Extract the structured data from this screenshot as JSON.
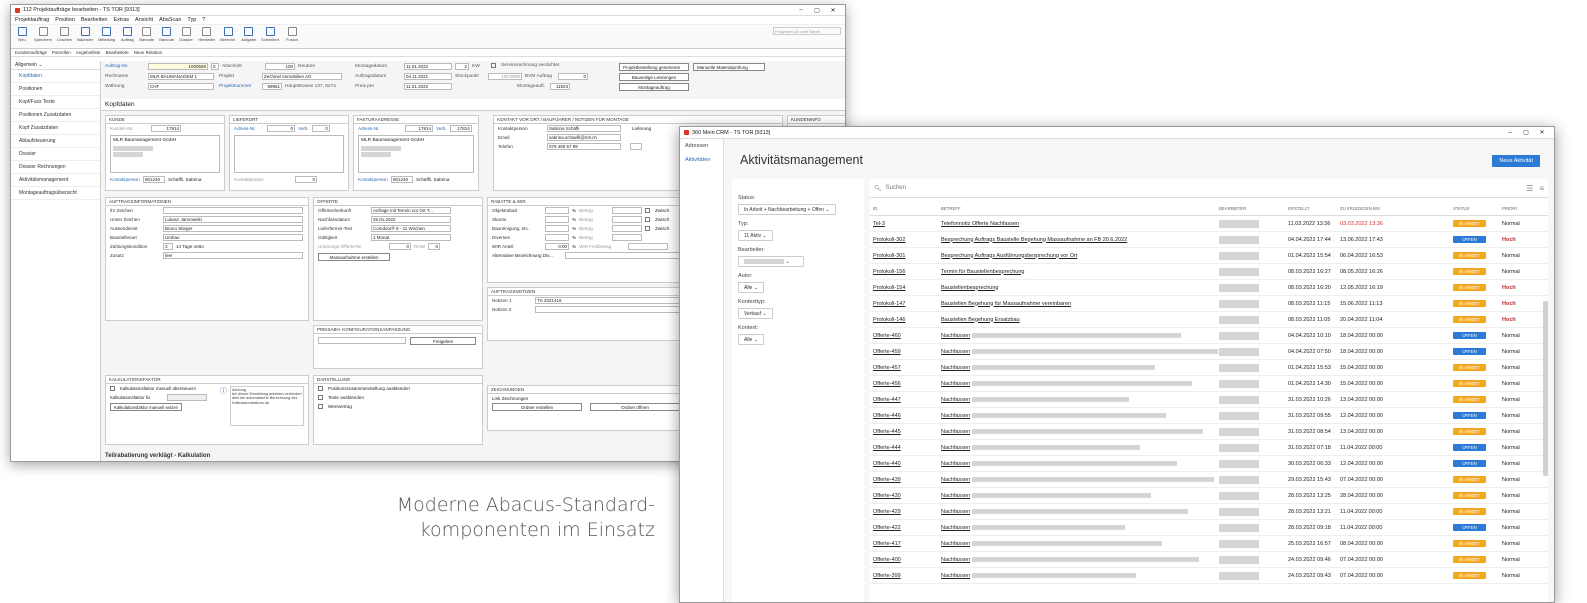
{
  "win1": {
    "title": "112 Projektaufträge bearbeiten - TS TOR [9313]",
    "menu": [
      "Projektauftrag",
      "Position",
      "Bearbeiten",
      "Extras",
      "Ansicht",
      "AbaScan",
      "Typ",
      "?"
    ],
    "ribbon": [
      "Neu",
      "Speichern",
      "Löschen",
      "Nächster",
      "Mitteilung",
      "Auftrag",
      "Barcode",
      "Barcode",
      "Dossier",
      "Hersteller",
      "Berechn.",
      "Aufgabe",
      "Schnellerf.",
      "Fusion"
    ],
    "program_search": "Programm-ID oder Name",
    "subbar": [
      "Kundenaufträge",
      "Parzellen",
      "Angebotliste",
      "Bearbeitete",
      "Neue Relation"
    ],
    "side_select": "Allgemein",
    "side_items": [
      "Kopfdaten",
      "Positionen",
      "Kopf/Fuss Texte",
      "Positionen Zusatzdaten",
      "Kopf Zusatzdaten",
      "Ablaufsteuerung",
      "Dossier",
      "Dossier Rechnungen",
      "Aktivitätsmanagement",
      "Montageauftragsübersicht"
    ],
    "header": {
      "auftrag_nr_label": "Auftrag-Nr.",
      "auftrag_nr": "1000568",
      "auftrag_nr_sub": "0",
      "abschnitt_label": "Abschnitt",
      "abschnitt": "100",
      "neutral": "Neutore",
      "montagedatum_label": "Montagedatum",
      "montagedatum": "11.01.2022",
      "kw_num": "2",
      "kw_label": "KW",
      "servicerechnung": "Servicerechnung verdichtet",
      "projektbestellung": "Projektbestellung generieren",
      "materialpruefung": "Manuelle Materialprüfung",
      "rechname_label": "Rechname",
      "rechname": "MLR BAUMANAGEM 1",
      "projekt_label": "Projekt",
      "projekt": "Zechinel Immobilien AG",
      "auftragsdatum_label": "Auftragsdatum",
      "auftragsdatum": "04.11.2021",
      "stockpunkt_label": "Stockpunkt",
      "stockpunkt": "100.0000",
      "bvm_label": "BVM Auftrag",
      "bvm": "0",
      "bauseitige": "Bauseitige Leistungen",
      "waehrung_label": "Währung",
      "waehrung": "CHF",
      "projektnummer_label": "Projektnummer",
      "projektnummer": "99961",
      "adresse": "Hauptstrasse 137, 8274",
      "preis_label": "Preis per",
      "preis": "11.01.2022",
      "montageauft_label": "Montageauft.",
      "montageauft": "11923",
      "montageauftrag": "Montageauftrag"
    },
    "section_title": "Kopfdaten",
    "kunde": {
      "title": "KUNDE",
      "kunden_nr_label": "Kunden-Nr.",
      "kunden_nr": "17814",
      "name": "MLR Baumanagement GmbH",
      "kontakt_label": "Kontaktperson",
      "kontakt_nr": "801240",
      "kontakt_name": "Schäffli, Sabrina"
    },
    "lieferort": {
      "title": "LIEFERORT",
      "adress_label": "Adress-Nr.",
      "adress_nr": "0",
      "verb_label": "Verb.",
      "verb": "0",
      "kontakt_label": "Kontaktperson",
      "kontakt_nr": "0"
    },
    "faktura": {
      "title": "FAKTURAADRESSE",
      "adress_label": "Adress-Nr.",
      "adress_nr": "17814",
      "verb_label": "Verb.",
      "verb": "17814",
      "name": "MLR Baumanagement GmbH",
      "kontakt_label": "Kontaktperson",
      "kontakt_nr": "801240",
      "kontakt_name": "Schäffli, Sabrina"
    },
    "kontakt": {
      "title": "KONTAKT VOR ORT / BAUFÜHRER / NOTIZEN FÜR MONTAGE",
      "person_label": "Kontaktperson",
      "person": "Sabrina Schäfli",
      "lieferung": "Lieferung",
      "email_label": "Email",
      "email": "sabrina.schaefli@mlr.ch",
      "telefon_label": "Telefon",
      "telefon": "079 469 57 99"
    },
    "kundeninfo": {
      "title": "KUNDENINFO"
    },
    "auftragsinfo": {
      "title": "AUFTRAGSINFORMATIONEN",
      "rows": [
        [
          "Ihr Zeichen",
          ""
        ],
        [
          "Unser Zeichen",
          "Lukasz Jamrowski"
        ],
        [
          "Aussendienst",
          "Bruno Stieger"
        ],
        [
          "Baustellenart",
          "Umbau"
        ],
        [
          "Zahlungskondition",
          "14 Tage netto"
        ],
        [
          "Zusatz",
          "leer"
        ]
      ],
      "zk_num": "3"
    },
    "offerte": {
      "title": "OFFERTE",
      "rows": [
        [
          "Offertenherkunft",
          "Anfrage mit Termin vor Ort T..."
        ],
        [
          "Nachfassdatum",
          "26.01.2022"
        ],
        [
          "Lieferfermin-Text",
          "Comdoor® 8 - 11 Wochen"
        ],
        [
          "Gültigkeit",
          "1 Monat"
        ],
        [
          "Ursprungs-Offerte-Nr.",
          "0"
        ]
      ],
      "rhw_label": "RHW",
      "rhw": "0",
      "masse_btn": "Massaufnahme erstellen"
    },
    "rabatte": {
      "title": "RABATTE & WIR",
      "rows": [
        "Objektrabatt",
        "Skonto",
        "Baureinigung, etc.",
        "Diverses"
      ],
      "pct": "%",
      "betrag": "Betrag",
      "zwisch": "Zwisch",
      "wir_label": "WIR Anteil",
      "wir": "0.00",
      "wir_pct": "%",
      "wir_fest": "WIR Festbetrag",
      "alt_label": "Alternative Bezeichnung Div..."
    },
    "preisanp": {
      "title": "PREISABH. KONFIGURATIONSANPASSUNG",
      "freigeben": "Freigeben"
    },
    "notizen": {
      "title": "AUFTRAGSNOTIZEN",
      "notiz1_label": "Notizen 1",
      "notiz1": "TS 2021416",
      "notiz2_label": "Notizen 2"
    },
    "kalk": {
      "title": "KALKULATIONSFAKTOR",
      "manuell": "Kalkulationsfaktor manuell übersteuern",
      "faktor_label": "Kalkulationsfaktor fix",
      "setzen": "Kalkulationsfaktor manuell setzen",
      "hint_title": "Achtung",
      "hint": "bei dieser Einstellung anbieten verhindert dies die automatische Berechnung des Kalkulationsfaktors ab"
    },
    "darstellung": {
      "title": "DARSTELLUNG",
      "items": [
        "Positionszusammenstellung ausblenden",
        "Texte ausblenden",
        "Wertvertrag"
      ]
    },
    "zeichnungen": {
      "title": "ZEICHNUNGEN",
      "link": "Link Zeichnungen",
      "erstellen": "Ordner erstellen",
      "oeffnen": "Ordner öffnen"
    },
    "bottom": "Teilrabatierung verklägt - Kalkulation"
  },
  "caption": [
    "Moderne Abacus-Standard-",
    "komponenten im Einsatz"
  ],
  "win2": {
    "title": "360 Mein CRM - TS TOR [9313]",
    "side": [
      "Adressen",
      "Aktivitäten"
    ],
    "app_title": "Aktivitätsmanagement",
    "new_btn": "Neue Aktivität",
    "search_placeholder": "Suchen",
    "filters": {
      "status_label": "Status:",
      "status": "In Arbeit + Nachbearbeitung + Offen",
      "typ_label": "Typ:",
      "typ": "11 Aktiv",
      "bearbeiter_label": "Bearbeiter:",
      "autor_label": "Autor:",
      "autor": "Alle",
      "kontexttyp_label": "Kontexttyp:",
      "kontexttyp": "Verkauf",
      "kontext_label": "Kontext:",
      "kontext": "Alle"
    },
    "columns": [
      "ID",
      "BETREFF",
      "BEARBEITER",
      "ERSTELLT",
      "ZU ERLEDIGEN BIS",
      "STATUS",
      "PRIORI"
    ],
    "rows": [
      {
        "id": "Tel-3",
        "betreff": "Telefonnotiz Offerte Nachfassen",
        "erstellt": "11.03.2022 13:36",
        "bis": "03.03.2022 13:36",
        "status": "IN ARBEIT",
        "prio": "Normal",
        "overdue": true
      },
      {
        "id": "Protokoll-302",
        "betreff": "Besprechung Auftrags Baustelle Begehung Massaufnahme an FB 20.6.2022",
        "erstellt": "04.04.2022 17:44",
        "bis": "13.06.2022 17:43",
        "status": "OFFEN",
        "prio": "Hoch"
      },
      {
        "id": "Protokoll-301",
        "betreff": "Besprechung Auftrags Ausführungsbesprechung vor Ort",
        "erstellt": "01.04.2022 15:54",
        "bis": "06.04.2022 16:53",
        "status": "IN ARBEIT",
        "prio": "Normal"
      },
      {
        "id": "Protokoll-156",
        "betreff": "Termin für Baustellenbesprechung",
        "erstellt": "08.03.2022 16:27",
        "bis": "08.05.2022 16:26",
        "status": "IN ARBEIT",
        "prio": "Normal"
      },
      {
        "id": "Protokoll-154",
        "betreff": "Baustellenbesprechung",
        "erstellt": "08.03.2022 16:20",
        "bis": "12.05.2022 16:19",
        "status": "IN ARBEIT",
        "prio": "Hoch"
      },
      {
        "id": "Protokoll-147",
        "betreff": "Baustellen Begehung für Massaufnahme vereinbaren",
        "erstellt": "08.03.2022 11:15",
        "bis": "15.06.2022 11:13",
        "status": "IN ARBEIT",
        "prio": "Hoch"
      },
      {
        "id": "Protokoll-146",
        "betreff": "Baustellen Begehung Ersatzbau",
        "erstellt": "08.03.2022 11:05",
        "bis": "20.04.2022 11:04",
        "status": "IN ARBEIT",
        "prio": "Hoch"
      },
      {
        "id": "Offerte-460",
        "betreff": "Nachfassen",
        "erstellt": "04.04.2022 10:10",
        "bis": "18.04.2022 00:00",
        "status": "OFFEN",
        "prio": "Normal"
      },
      {
        "id": "Offerte-459",
        "betreff": "Nachfassen",
        "erstellt": "04.04.2022 07:50",
        "bis": "18.04.2022 00:00",
        "status": "OFFEN",
        "prio": "Normal"
      },
      {
        "id": "Offerte-457",
        "betreff": "Nachfassen",
        "erstellt": "01.04.2022 15:53",
        "bis": "15.04.2022 00:00",
        "status": "IN ARBEIT",
        "prio": "Normal"
      },
      {
        "id": "Offerte-456",
        "betreff": "Nachfassen",
        "erstellt": "01.04.2022 14:30",
        "bis": "15.04.2022 00:00",
        "status": "IN ARBEIT",
        "prio": "Normal"
      },
      {
        "id": "Offerte-447",
        "betreff": "Nachfassen",
        "erstellt": "31.03.2022 10:26",
        "bis": "13.04.2022 00:00",
        "status": "IN ARBEIT",
        "prio": "Normal"
      },
      {
        "id": "Offerte-446",
        "betreff": "Nachfassen",
        "erstellt": "31.03.2022 09:55",
        "bis": "12.04.2022 00:00",
        "status": "OFFEN",
        "prio": "Normal"
      },
      {
        "id": "Offerte-445",
        "betreff": "Nachfassen",
        "erstellt": "31.03.2022 08:54",
        "bis": "13.04.2022 00:00",
        "status": "IN ARBEIT",
        "prio": "Normal"
      },
      {
        "id": "Offerte-444",
        "betreff": "Nachfassen",
        "erstellt": "31.03.2022 07:18",
        "bis": "11.04.2022 00:00",
        "status": "OFFEN",
        "prio": "Normal"
      },
      {
        "id": "Offerte-440",
        "betreff": "Nachfassen",
        "erstellt": "30.03.2022 06:33",
        "bis": "12.04.2022 00:00",
        "status": "OFFEN",
        "prio": "Normal"
      },
      {
        "id": "Offerte-439",
        "betreff": "Nachfassen",
        "erstellt": "29.03.2022 15:43",
        "bis": "07.04.2022 00:00",
        "status": "IN ARBEIT",
        "prio": "Normal"
      },
      {
        "id": "Offerte-430",
        "betreff": "Nachfassen",
        "erstellt": "28.03.2022 13:25",
        "bis": "28.04.2022 00:00",
        "status": "IN ARBEIT",
        "prio": "Normal"
      },
      {
        "id": "Offerte-429",
        "betreff": "Nachfassen",
        "erstellt": "28.03.2022 13:21",
        "bis": "11.04.2022 00:00",
        "status": "IN ARBEIT",
        "prio": "Normal"
      },
      {
        "id": "Offerte-422",
        "betreff": "Nachfassen",
        "erstellt": "28.03.2022 09:18",
        "bis": "11.04.2022 00:00",
        "status": "OFFEN",
        "prio": "Normal"
      },
      {
        "id": "Offerte-417",
        "betreff": "Nachfassen",
        "erstellt": "25.03.2022 16:57",
        "bis": "08.04.2022 00:00",
        "status": "IN ARBEIT",
        "prio": "Normal"
      },
      {
        "id": "Offerte-400",
        "betreff": "Nachfassen",
        "erstellt": "24.03.2022 09:46",
        "bis": "07.04.2022 00:00",
        "status": "IN ARBEIT",
        "prio": "Normal"
      },
      {
        "id": "Offerte-399",
        "betreff": "Nachfassen",
        "erstellt": "24.03.2022 09:43",
        "bis": "07.04.2022 00:00",
        "status": "IN ARBEIT",
        "prio": "Normal"
      }
    ]
  },
  "colors": {
    "accent": "#2a7ad6",
    "in_arbeit": "#f4a81c",
    "offen": "#2a7ad6",
    "hoch": "#c62828"
  }
}
